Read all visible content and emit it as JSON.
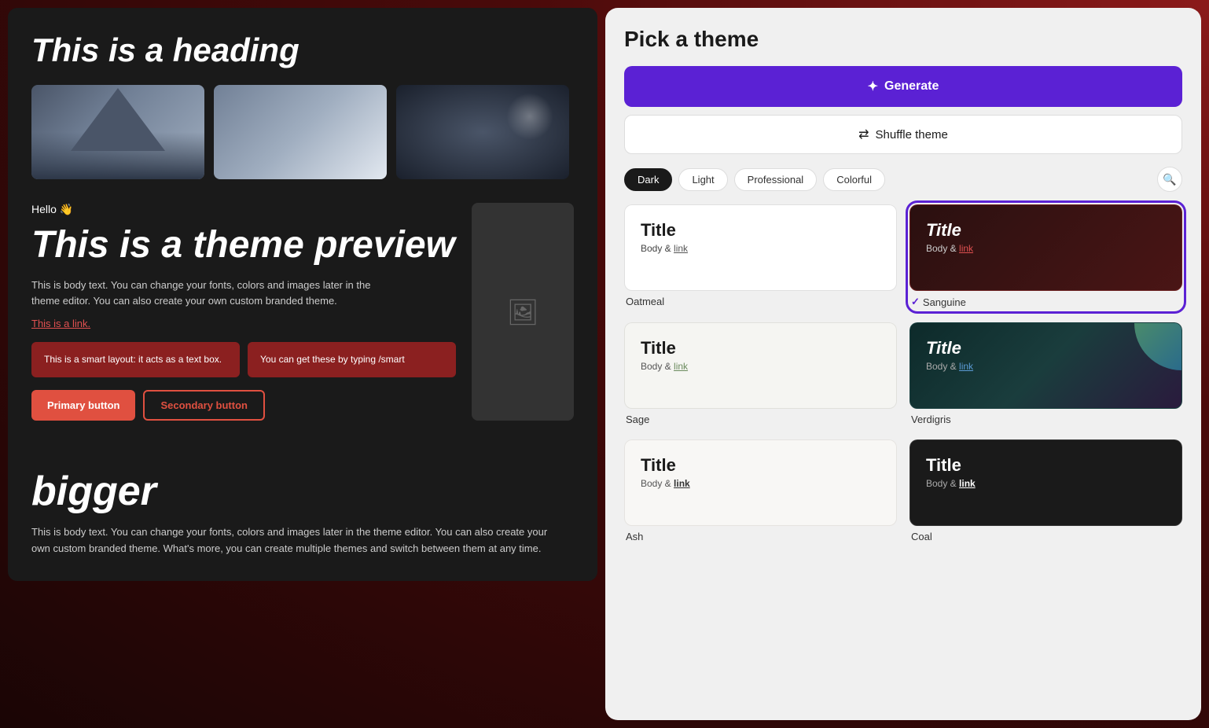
{
  "left": {
    "top": {
      "heading": "This is a heading"
    },
    "preview": {
      "hello": "Hello 👋",
      "title": "This is a theme preview",
      "body": "This is body text. You can change your fonts, colors and images later in the theme editor. You can also create your own custom branded theme.",
      "link": "This is a link.",
      "smart_box_1": "This is a smart layout: it acts as a text box.",
      "smart_box_2": "You can get these by typing /smart",
      "btn_primary": "Primary button",
      "btn_secondary": "Secondary button"
    },
    "bottom": {
      "heading": "bigger",
      "body": "This is body text. You can change your fonts, colors and images later in the theme editor. You can also create your own custom branded theme. What's more, you can create multiple themes and switch between them at any time."
    }
  },
  "right": {
    "title": "Pick a theme",
    "generate_label": "Generate",
    "shuffle_label": "Shuffle theme",
    "filters": [
      "Dark",
      "Light",
      "Professional",
      "Colorful"
    ],
    "active_filter": "Dark",
    "themes": [
      {
        "id": "oatmeal",
        "name": "Oatmeal",
        "title": "Title",
        "body": "Body & ",
        "link": "link",
        "scheme": "oatmeal",
        "selected": false
      },
      {
        "id": "sanguine",
        "name": "Sanguine",
        "title": "Title",
        "body": "Body & ",
        "link": "link",
        "scheme": "sanguine",
        "selected": true
      },
      {
        "id": "sage",
        "name": "Sage",
        "title": "Title",
        "body": "Body & ",
        "link": "link",
        "scheme": "sage",
        "selected": false
      },
      {
        "id": "verdigris",
        "name": "Verdigris",
        "title": "Title",
        "body": "Body & ",
        "link": "link",
        "scheme": "verdigris",
        "selected": false
      },
      {
        "id": "ash",
        "name": "Ash",
        "title": "Title",
        "body": "Body & ",
        "link": "link",
        "scheme": "ash",
        "selected": false
      },
      {
        "id": "coal",
        "name": "Coal",
        "title": "Title",
        "body": "Body & ",
        "link": "link",
        "scheme": "coal",
        "selected": false
      }
    ]
  }
}
